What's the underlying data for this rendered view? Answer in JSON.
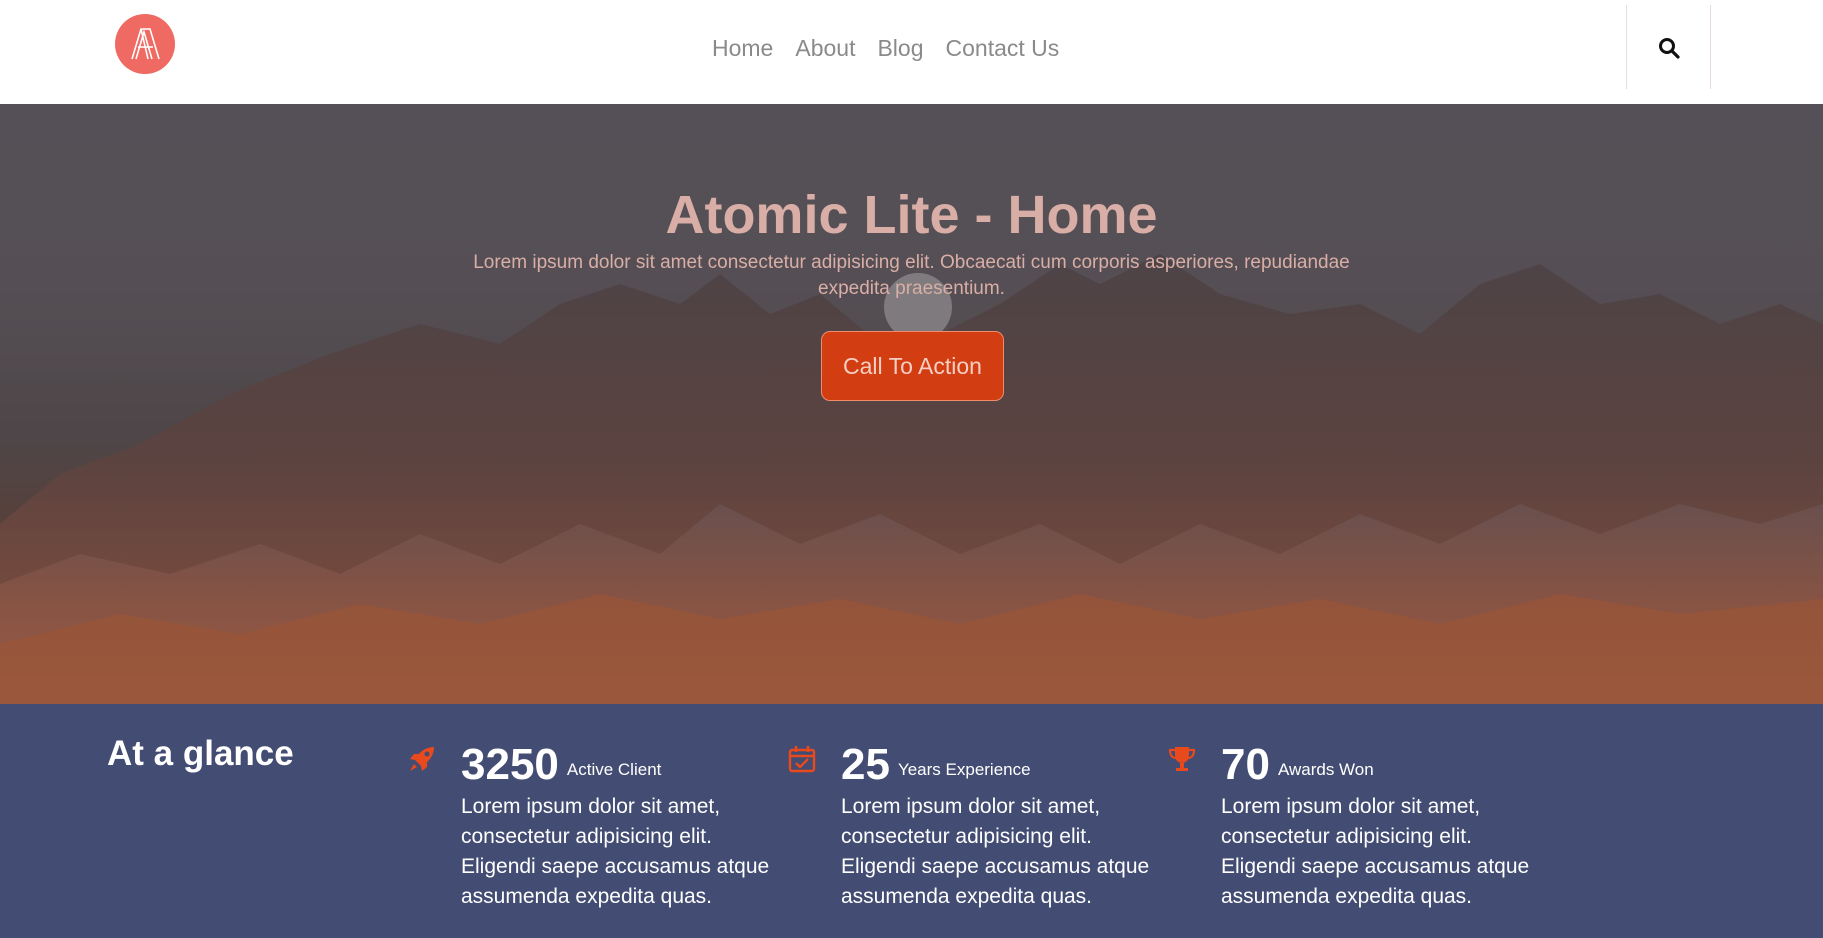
{
  "header": {
    "logo_alt": "A",
    "nav": [
      {
        "label": "Home"
      },
      {
        "label": "About"
      },
      {
        "label": "Blog"
      },
      {
        "label": "Contact Us"
      }
    ],
    "search_icon": "search-icon"
  },
  "hero": {
    "title": "Atomic Lite - Home",
    "subtitle": "Lorem ipsum dolor sit amet consectetur adipisicing elit. Obcaecati cum corporis asperiores, repudiandae expedita praesentium.",
    "cta_label": "Call To Action"
  },
  "stats": {
    "title": "At a glance",
    "items": [
      {
        "icon": "rocket-icon",
        "number": "3250",
        "unit": "Active Client",
        "text": "Lorem ipsum dolor sit amet, consectetur adipisicing elit. Eligendi saepe accusamus atque assumenda expedita quas."
      },
      {
        "icon": "calendar-check-icon",
        "number": "25",
        "unit": "Years Experience",
        "text": "Lorem ipsum dolor sit amet, consectetur adipisicing elit. Eligendi saepe accusamus atque assumenda expedita quas."
      },
      {
        "icon": "trophy-icon",
        "number": "70",
        "unit": "Awards Won",
        "text": "Lorem ipsum dolor sit amet, consectetur adipisicing elit. Eligendi saepe accusamus atque assumenda expedita quas."
      }
    ]
  },
  "colors": {
    "logo": "#ef6a62",
    "cta": "#d23d12",
    "stats_bg": "#434c72",
    "icon_accent": "#e8491d",
    "hero_text": "#d9aea6"
  }
}
